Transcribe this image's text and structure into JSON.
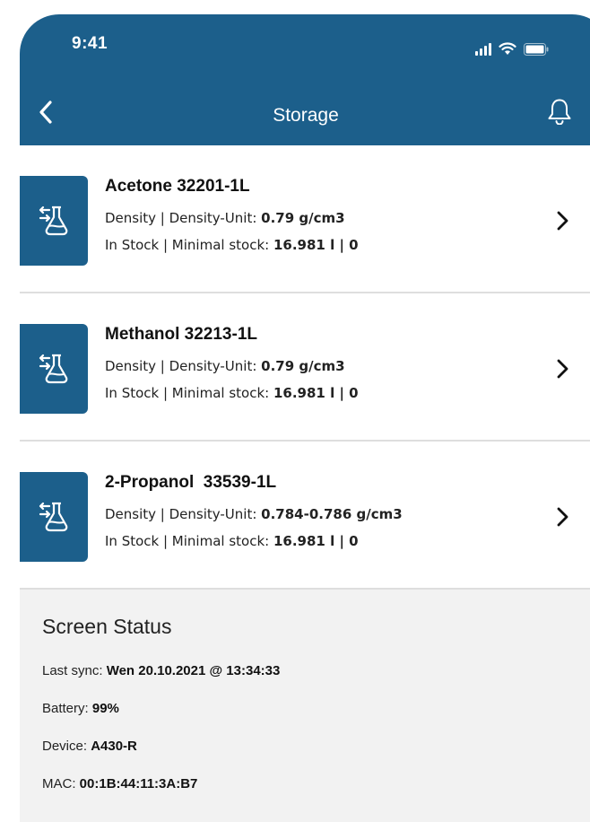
{
  "status_bar": {
    "time": "9:41",
    "icons": [
      "signal-icon",
      "wifi-icon",
      "battery-icon"
    ]
  },
  "nav": {
    "title": "Storage",
    "back_icon": "chevron-left-icon",
    "bell_icon": "bell-icon"
  },
  "colors": {
    "primary": "#1c5f8b",
    "background": "#f2f2f2",
    "card": "#ffffff"
  },
  "items": [
    {
      "title": "Acetone 32201-1L",
      "density_label": "Density | Density-Unit: ",
      "density_value": "0.79 g/cm3",
      "stock_label": "In Stock | Minimal stock: ",
      "stock_value": "16.981 l | 0",
      "icon": "flask-transfer-icon"
    },
    {
      "title": "Methanol 32213-1L",
      "density_label": "Density | Density-Unit: ",
      "density_value": "0.79 g/cm3",
      "stock_label": "In Stock | Minimal stock: ",
      "stock_value": "16.981 l | 0",
      "icon": "flask-transfer-icon"
    },
    {
      "title": "2-Propanol  33539-1L",
      "density_label": "Density | Density-Unit: ",
      "density_value": "0.784-0.786 g/cm3",
      "stock_label": "In Stock | Minimal stock: ",
      "stock_value": "16.981 l | 0",
      "icon": "flask-transfer-icon"
    }
  ],
  "screen_status": {
    "heading": "Screen Status",
    "rows": [
      {
        "label": "Last sync: ",
        "value": "Wen 20.10.2021 @ 13:34:33"
      },
      {
        "label": "Battery: ",
        "value": "99%"
      },
      {
        "label": "Device: ",
        "value": "A430-R"
      },
      {
        "label": "MAC: ",
        "value": "00:1B:44:11:3A:B7"
      }
    ]
  }
}
